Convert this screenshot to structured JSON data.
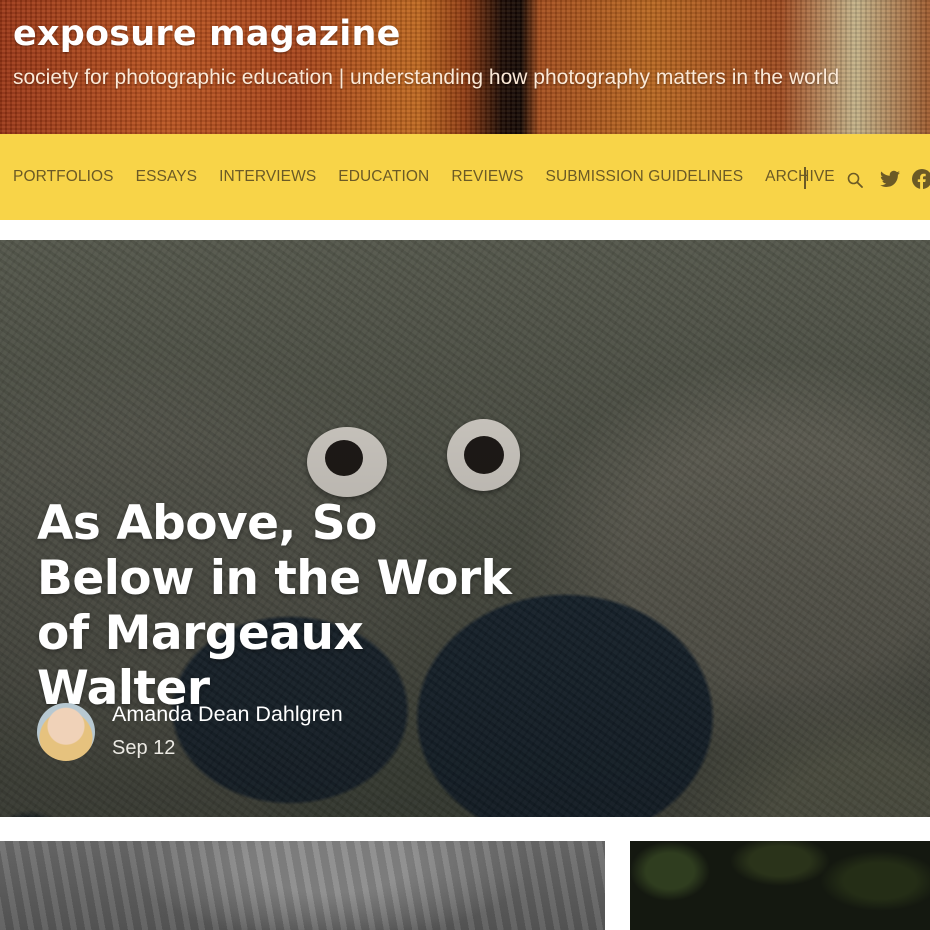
{
  "site": {
    "title": "exposure magazine",
    "tagline": "society for photographic education | understanding how photography matters in the world"
  },
  "nav": {
    "items": [
      "PORTFOLIOS",
      "ESSAYS",
      "INTERVIEWS",
      "EDUCATION",
      "REVIEWS",
      "SUBMISSION GUIDELINES",
      "ARCHIVE"
    ],
    "icons": [
      "search-icon",
      "twitter-icon",
      "facebook-icon"
    ]
  },
  "featured": {
    "headline": "As Above, So Below in the Work of Margeaux Walter",
    "author": "Amanda Dean Dahlgren",
    "date": "Sep 12"
  },
  "colors": {
    "nav_background": "#f8d448",
    "nav_text": "#6b5a26",
    "title_text": "#ffffff"
  }
}
